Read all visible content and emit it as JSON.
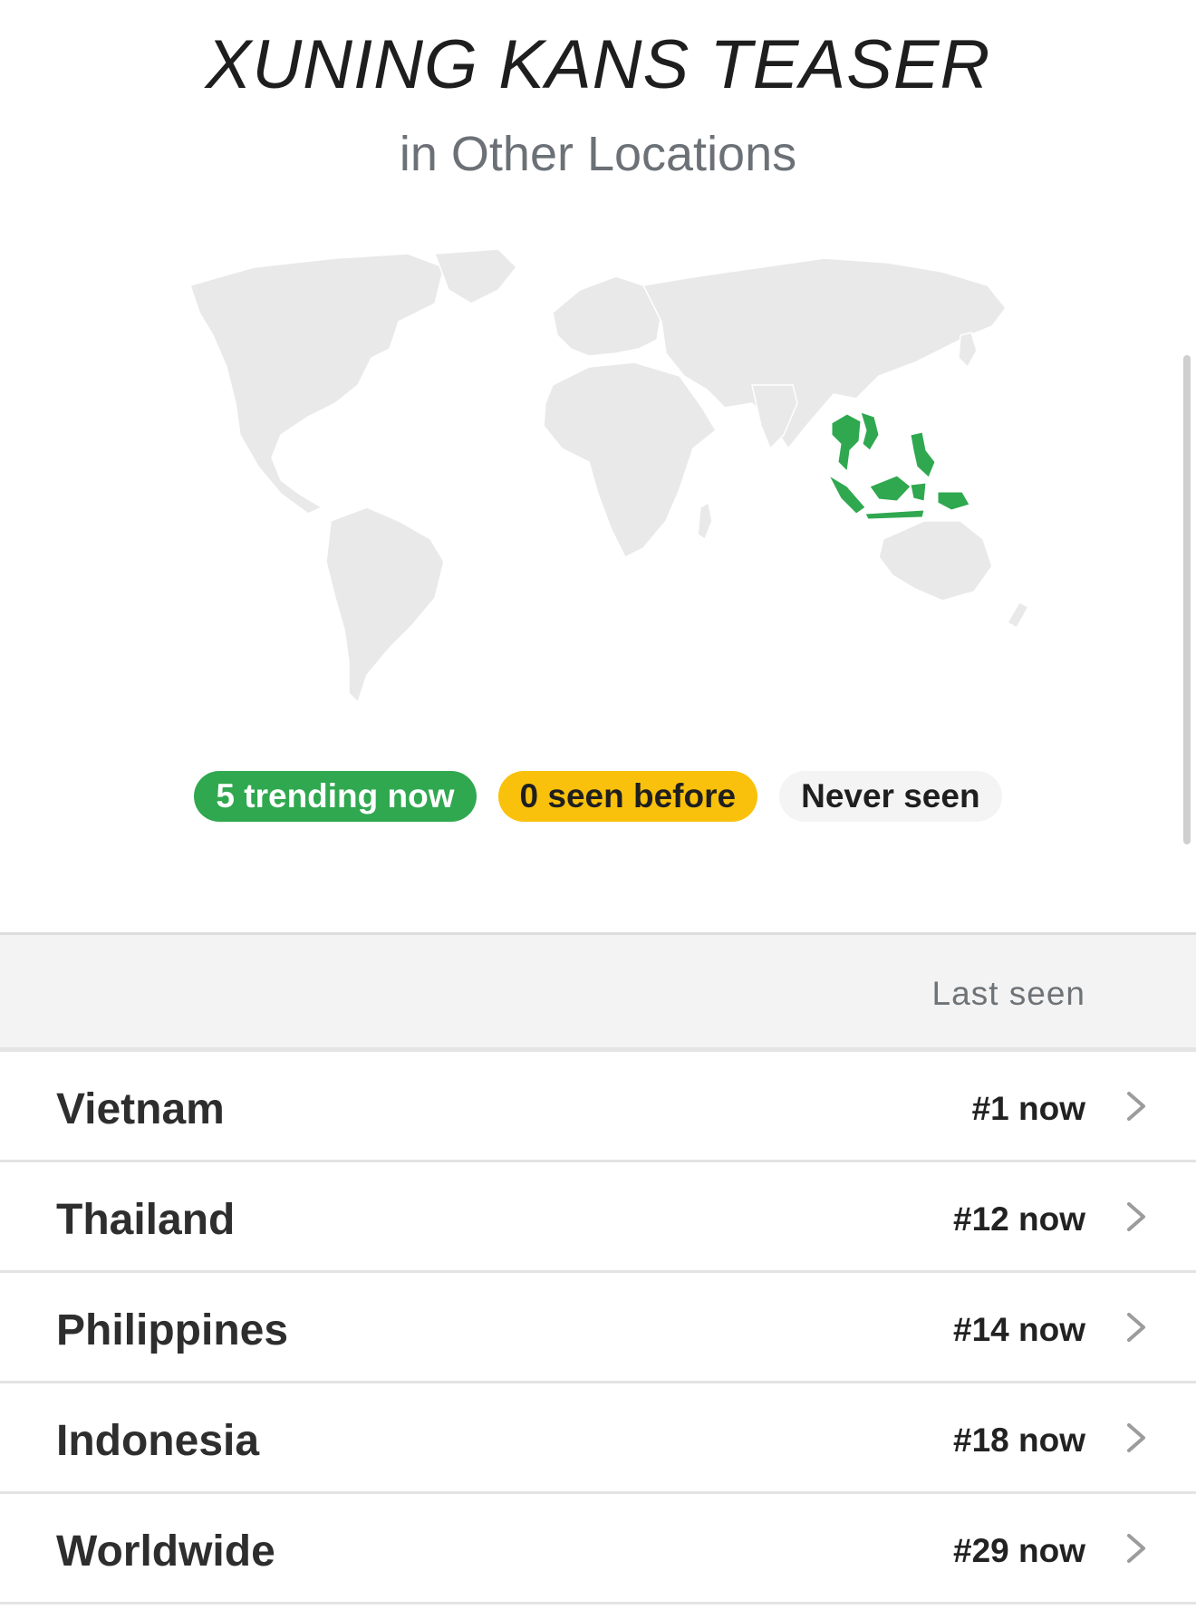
{
  "header": {
    "title": "XUNING KANS TEASER",
    "subtitle": "in Other Locations"
  },
  "map": {
    "base_color": "#e9e9e9",
    "highlight_color": "#2fa84f",
    "highlighted_regions": [
      "Vietnam",
      "Thailand",
      "Philippines",
      "Indonesia"
    ]
  },
  "legend": {
    "trending": {
      "label": "5 trending now",
      "color": "#2fa84f"
    },
    "seen_before": {
      "label": "0 seen before",
      "color": "#f9c10b"
    },
    "never_seen": {
      "label": "Never seen"
    }
  },
  "table": {
    "column_header": "Last seen",
    "rows": [
      {
        "location": "Vietnam",
        "rank": "#1 now"
      },
      {
        "location": "Thailand",
        "rank": "#12 now"
      },
      {
        "location": "Philippines",
        "rank": "#14 now"
      },
      {
        "location": "Indonesia",
        "rank": "#18 now"
      },
      {
        "location": "Worldwide",
        "rank": "#29 now"
      }
    ]
  },
  "icons": {
    "row_chevron": "chevron-right-icon"
  }
}
